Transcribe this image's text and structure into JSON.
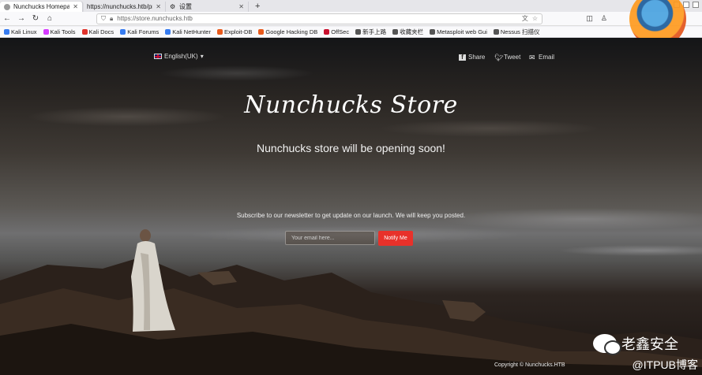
{
  "tabs": [
    {
      "label": "Nunchucks Homepage",
      "active": true
    },
    {
      "label": "https://nunchucks.htb/privac",
      "active": false
    },
    {
      "label": "设置",
      "active": false
    }
  ],
  "nav": {
    "url": "https://store.nunchucks.htb"
  },
  "bookmarks": [
    {
      "label": "Kali Linux",
      "color": "#367bf0"
    },
    {
      "label": "Kali Tools",
      "color": "#d63aff"
    },
    {
      "label": "Kali Docs",
      "color": "#e0322b"
    },
    {
      "label": "Kali Forums",
      "color": "#367bf0"
    },
    {
      "label": "Kali NetHunter",
      "color": "#367bf0"
    },
    {
      "label": "Exploit-DB",
      "color": "#e85a1c"
    },
    {
      "label": "Google Hacking DB",
      "color": "#e85a1c"
    },
    {
      "label": "OffSec",
      "color": "#c8102e"
    },
    {
      "label": "新手上路",
      "color": "#555555"
    },
    {
      "label": "收藏夹栏",
      "color": "#555555"
    },
    {
      "label": "Metasploit web Gui",
      "color": "#555555"
    },
    {
      "label": "Nessus 扫描仪",
      "color": "#555555"
    }
  ],
  "site": {
    "language": "English(UK)",
    "share": "Share",
    "tweet": "Tweet",
    "email_link": "Email",
    "title": "Nunchucks Store",
    "subtitle": "Nunchucks store will be opening soon!",
    "newsletter": "Subscribe to our newsletter to get update on our launch. We will keep you posted.",
    "email_placeholder": "Your email here...",
    "notify": "Notify Me",
    "copyright": "Copyright © Nunchucks.HTB",
    "accent": "#e8312a"
  },
  "watermark": {
    "line1": "老鑫安全",
    "line2": "@ITPUB博客"
  }
}
